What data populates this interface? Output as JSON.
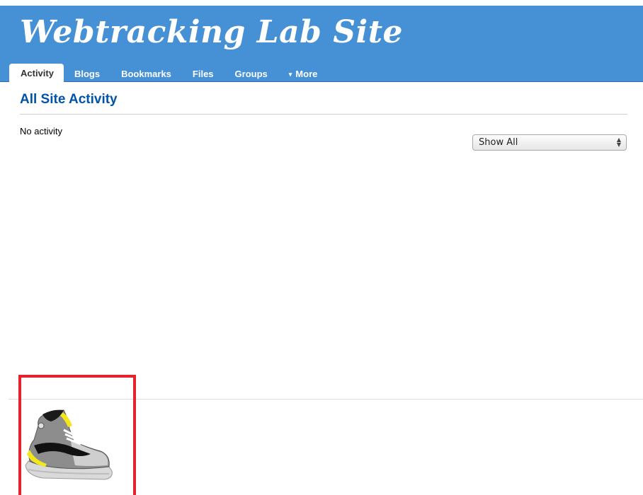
{
  "site": {
    "title": "Webtracking Lab Site"
  },
  "nav": {
    "tabs": [
      {
        "label": "Activity",
        "active": true
      },
      {
        "label": "Blogs",
        "active": false
      },
      {
        "label": "Bookmarks",
        "active": false
      },
      {
        "label": "Files",
        "active": false
      },
      {
        "label": "Groups",
        "active": false
      },
      {
        "label": "More",
        "active": false,
        "has_caret": true,
        "caret": "▾"
      }
    ]
  },
  "main": {
    "title": "All Site Activity",
    "empty_message": "No activity",
    "filter": {
      "selected": "Show All"
    }
  },
  "ad": {
    "image": "sneaker-ad-image",
    "highlight_color": "#e8222a"
  },
  "colors": {
    "header_bg": "#4690d6",
    "page_title": "#0054a7",
    "highlight": "#e8222a"
  }
}
